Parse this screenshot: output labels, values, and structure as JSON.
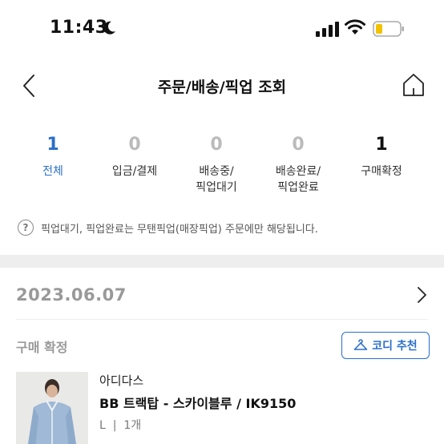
{
  "status_bar": {
    "time": "11:43"
  },
  "header": {
    "title": "주문/배송/픽업 조회"
  },
  "summary": [
    {
      "count": "1",
      "label": "전체"
    },
    {
      "count": "0",
      "label": "입금/결제"
    },
    {
      "count": "0",
      "label": "배송중/\n픽업대기"
    },
    {
      "count": "0",
      "label": "배송완료/\n픽업완료"
    },
    {
      "count": "1",
      "label": "구매확정"
    }
  ],
  "notice": {
    "icon": "?",
    "text": "픽업대기, 픽업완료는 무탠픽업(매장픽업) 주문에만 해당됩니다."
  },
  "order": {
    "date": "2023.06.07",
    "status": "구매 확정",
    "coordi_button": "코디 추천",
    "product": {
      "brand": "아디다스",
      "name": "BB 트랙탑 - 스카이블루 / IK9150",
      "option": "L  |  1개"
    }
  },
  "colors": {
    "accent": "#2a6fc9",
    "muted": "#999999",
    "divider": "#eeeeee"
  }
}
